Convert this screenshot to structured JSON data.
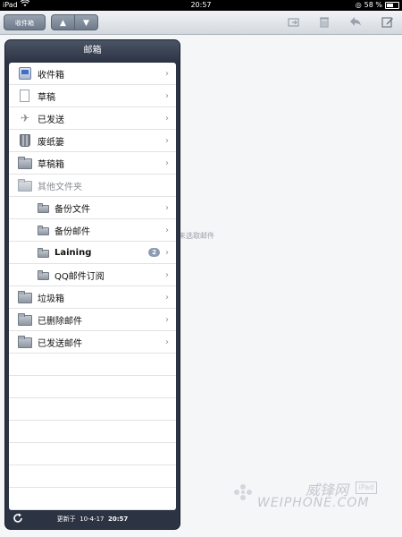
{
  "status_bar": {
    "device": "iPad",
    "time": "20:57",
    "battery": "58 %",
    "battery_level": 0.58
  },
  "toolbar": {
    "inbox_button": "收件箱",
    "up_arrow": "▲",
    "down_arrow": "▼",
    "icons": [
      "folder-move-icon",
      "trash-icon",
      "reply-icon",
      "compose-icon"
    ]
  },
  "main": {
    "empty_message": "未选取邮件"
  },
  "popover": {
    "title": "邮箱",
    "items": [
      {
        "label": "收件箱",
        "icon": "inbox-icon"
      },
      {
        "label": "草稿",
        "icon": "draft-icon"
      },
      {
        "label": "已发送",
        "icon": "sent-icon"
      },
      {
        "label": "废纸篓",
        "icon": "trash-icon"
      },
      {
        "label": "草稿箱",
        "icon": "folder-icon"
      },
      {
        "label": "其他文件夹",
        "icon": "folder-icon"
      },
      {
        "label": "备份文件",
        "icon": "folder-icon"
      },
      {
        "label": "备份邮件",
        "icon": "folder-icon"
      },
      {
        "label": "Laining",
        "icon": "folder-icon",
        "badge": "2"
      },
      {
        "label": "QQ邮件订阅",
        "icon": "folder-icon"
      },
      {
        "label": "垃圾箱",
        "icon": "folder-icon"
      },
      {
        "label": "已删除邮件",
        "icon": "folder-icon"
      },
      {
        "label": "已发送邮件",
        "icon": "folder-icon"
      }
    ],
    "footer": {
      "prefix": "更新于",
      "date": "10-4-17",
      "time": "20:57"
    }
  },
  "watermark": {
    "cn": "威锋网",
    "box": "iPad",
    "en": "WEIPHONE.COM"
  }
}
